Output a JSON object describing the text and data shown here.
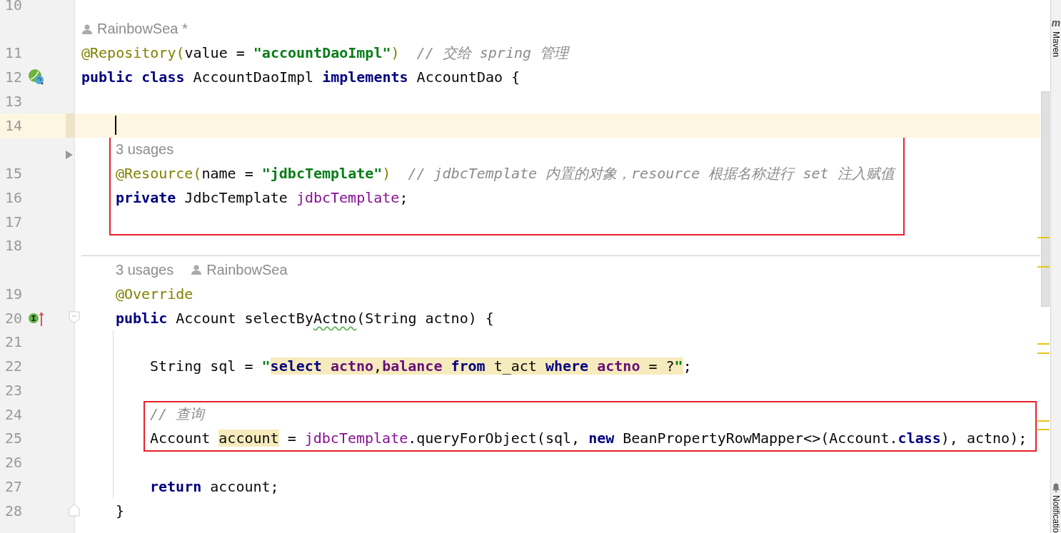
{
  "lines": [
    {
      "kind": "code",
      "number": "10"
    },
    {
      "kind": "inlay",
      "parts": [
        {
          "kind": "author",
          "text": "RainbowSea *"
        }
      ]
    },
    {
      "kind": "code",
      "number": "11",
      "tokens": [
        {
          "kind": "ann",
          "text": "@Repository("
        },
        {
          "kind": "plain",
          "text": "value = "
        },
        {
          "kind": "str",
          "text": "\"accountDaoImpl\""
        },
        {
          "kind": "ann",
          "text": ")"
        },
        {
          "kind": "comment",
          "text": "  // 交给 spring 管理"
        }
      ]
    },
    {
      "kind": "code",
      "number": "12",
      "gutter_icon": {
        "kind": "bean"
      },
      "tokens": [
        {
          "kind": "kw",
          "text": "public class"
        },
        {
          "kind": "plain",
          "text": " AccountDaoImpl "
        },
        {
          "kind": "kw",
          "text": "implements"
        },
        {
          "kind": "plain",
          "text": " AccountDao {"
        }
      ]
    },
    {
      "kind": "block",
      "children": [
        {
          "kind": "code",
          "number": "13"
        },
        {
          "kind": "code",
          "number": "14",
          "current": true
        },
        {
          "kind": "box",
          "children": [
            {
              "kind": "inlay",
              "fold": {
                "kind": "collapsed"
              },
              "parts": [
                {
                  "kind": "text",
                  "text": "3 usages"
                }
              ]
            },
            {
              "kind": "code",
              "number": "15",
              "tokens": [
                {
                  "kind": "ann",
                  "text": "@Resource("
                },
                {
                  "kind": "plain",
                  "text": "name = "
                },
                {
                  "kind": "str",
                  "text": "\"jdbcTemplate\""
                },
                {
                  "kind": "ann",
                  "text": ")"
                },
                {
                  "kind": "comment",
                  "text": "  // jdbcTemplate 内置的对象，resource 根据名称进行 set 注入赋值"
                }
              ]
            },
            {
              "kind": "code",
              "number": "16",
              "tokens": [
                {
                  "kind": "kw",
                  "text": "private"
                },
                {
                  "kind": "plain",
                  "text": " JdbcTemplate "
                },
                {
                  "kind": "field",
                  "text": "jdbcTemplate"
                },
                {
                  "kind": "plain",
                  "text": ";"
                }
              ]
            },
            {
              "kind": "code",
              "number": "17"
            }
          ]
        },
        {
          "kind": "code",
          "number": "18",
          "separator": true
        },
        {
          "kind": "inlay",
          "parts": [
            {
              "kind": "text",
              "text": "3 usages"
            },
            {
              "kind": "author",
              "text": "RainbowSea"
            }
          ]
        },
        {
          "kind": "code",
          "number": "19",
          "tokens": [
            {
              "kind": "ann",
              "text": "@Override"
            }
          ]
        },
        {
          "kind": "code",
          "number": "20",
          "gutter_icon": {
            "kind": "implements"
          },
          "fold": {
            "kind": "start"
          },
          "tokens": [
            {
              "kind": "kw",
              "text": "public"
            },
            {
              "kind": "plain",
              "text": " Account selectBy"
            },
            {
              "kind": "typo",
              "text": "Actno"
            },
            {
              "kind": "plain",
              "text": "(String actno) {"
            }
          ]
        },
        {
          "kind": "block",
          "guide": true,
          "children": [
            {
              "kind": "code",
              "number": "21"
            },
            {
              "kind": "code",
              "number": "22",
              "tokens": [
                {
                  "kind": "plain",
                  "text": "String sql = "
                },
                {
                  "kind": "str",
                  "text": "\""
                },
                {
                  "kind": "sqlkw",
                  "text": "select"
                },
                {
                  "kind": "sqlcol",
                  "text": " actno"
                },
                {
                  "kind": "sql",
                  "text": ","
                },
                {
                  "kind": "sqlcol",
                  "text": "balance"
                },
                {
                  "kind": "sqlkw",
                  "text": " from"
                },
                {
                  "kind": "sql",
                  "text": " t_act "
                },
                {
                  "kind": "sqlkw",
                  "text": "where"
                },
                {
                  "kind": "sqlcol",
                  "text": " actno"
                },
                {
                  "kind": "sql",
                  "text": " = ?"
                },
                {
                  "kind": "strhl",
                  "text": "\""
                },
                {
                  "kind": "plain",
                  "text": ";"
                }
              ]
            },
            {
              "kind": "code",
              "number": "23"
            },
            {
              "kind": "box",
              "children": [
                {
                  "kind": "code",
                  "number": "24",
                  "tokens": [
                    {
                      "kind": "comment",
                      "text": "// 查询"
                    }
                  ]
                },
                {
                  "kind": "code",
                  "number": "25",
                  "tokens": [
                    {
                      "kind": "plain",
                      "text": "Account "
                    },
                    {
                      "kind": "hl",
                      "text": "account"
                    },
                    {
                      "kind": "plain",
                      "text": " = "
                    },
                    {
                      "kind": "field",
                      "text": "jdbcTemplate"
                    },
                    {
                      "kind": "plain",
                      "text": ".queryForObject(sql, "
                    },
                    {
                      "kind": "kw",
                      "text": "new"
                    },
                    {
                      "kind": "plain",
                      "text": " BeanPropertyRowMapper<>(Account."
                    },
                    {
                      "kind": "kw",
                      "text": "class"
                    },
                    {
                      "kind": "plain",
                      "text": "), actno);"
                    }
                  ]
                }
              ]
            },
            {
              "kind": "code",
              "number": "26"
            },
            {
              "kind": "code",
              "number": "27",
              "tokens": [
                {
                  "kind": "kw",
                  "text": "return"
                },
                {
                  "kind": "plain",
                  "text": " account;"
                }
              ]
            }
          ]
        },
        {
          "kind": "code",
          "number": "28",
          "fold": {
            "kind": "end"
          },
          "tokens": [
            {
              "kind": "plain",
              "text": "}"
            }
          ]
        }
      ]
    }
  ],
  "tool_strip": {
    "maven_glyph": "m",
    "top_label": "Maven",
    "bottom_label": "Notificatio"
  }
}
